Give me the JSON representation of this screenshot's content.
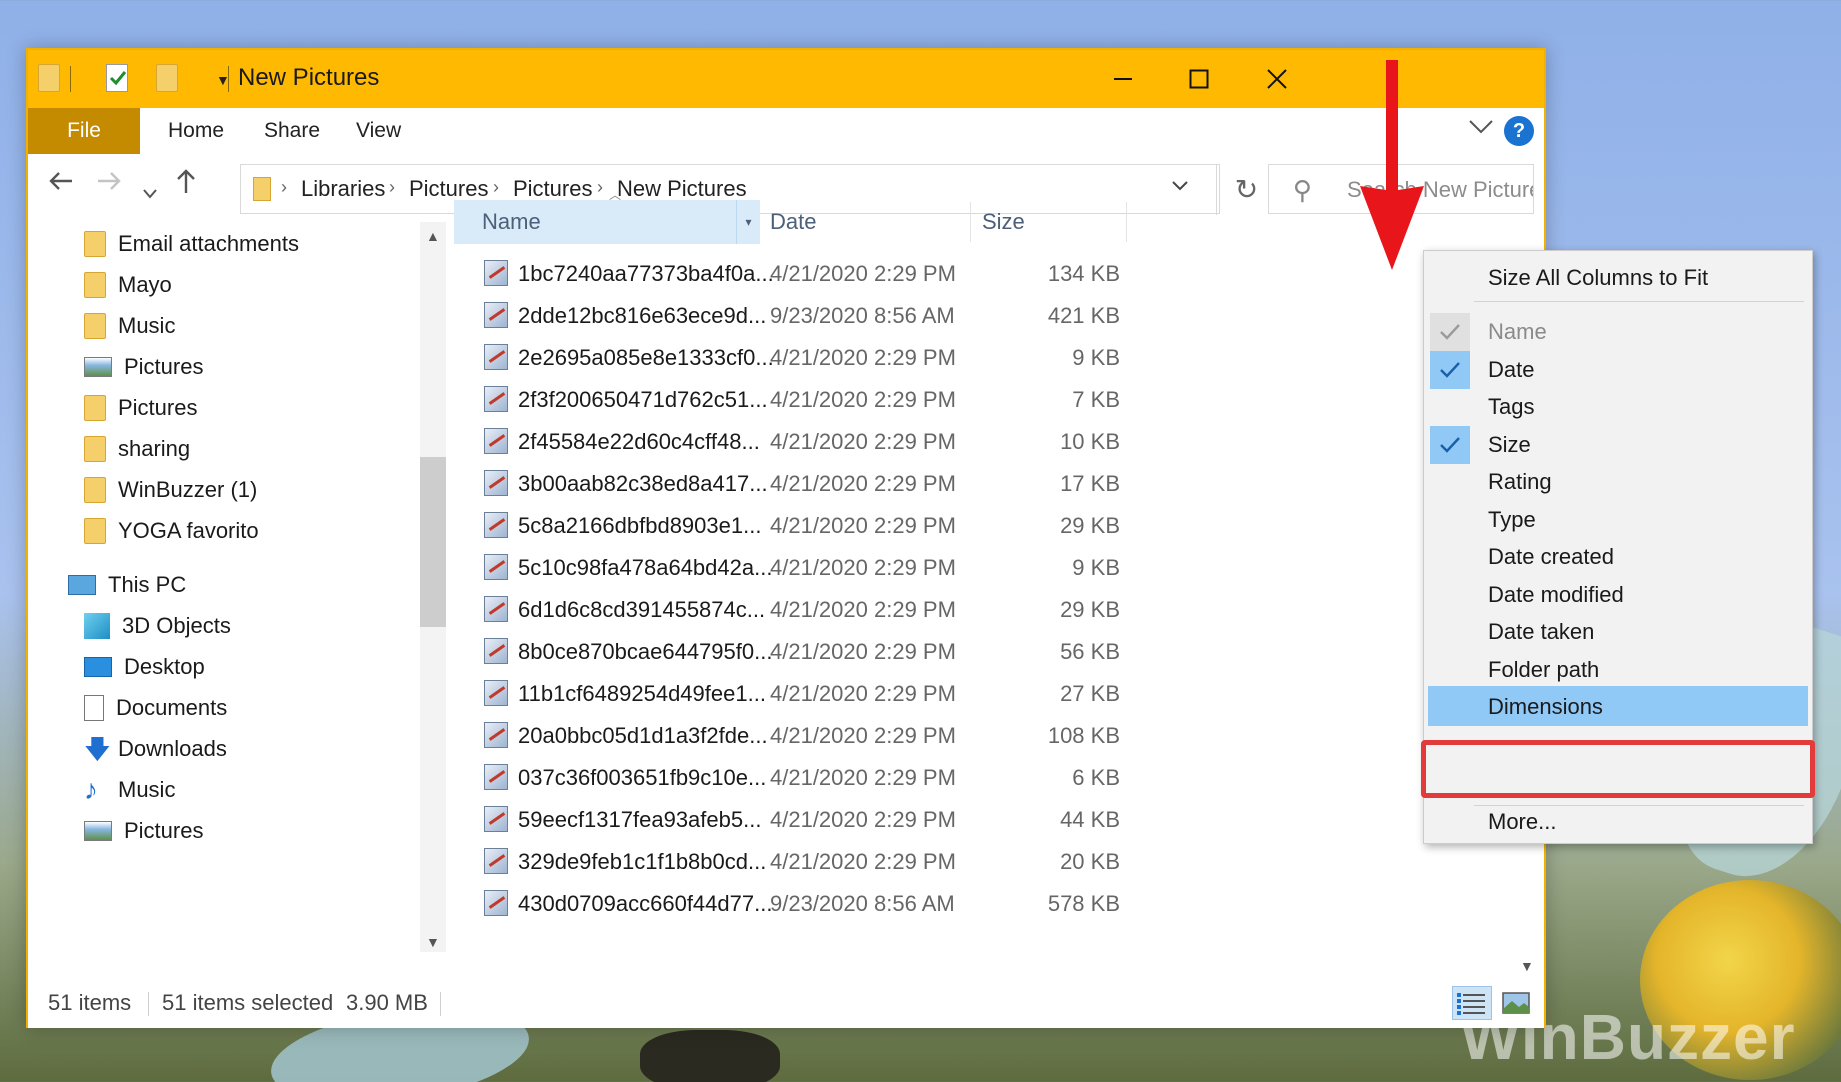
{
  "window": {
    "title": "New Pictures"
  },
  "ribbon": {
    "tabs": [
      "File",
      "Home",
      "Share",
      "View"
    ]
  },
  "address": {
    "crumbs": [
      "Libraries",
      "Pictures",
      "Pictures",
      "New Pictures"
    ]
  },
  "search": {
    "placeholder": "Search New Pictures"
  },
  "nav_pane": {
    "items": [
      {
        "label": "Email attachments",
        "icon": "folder-icon"
      },
      {
        "label": "Mayo",
        "icon": "folder-icon"
      },
      {
        "label": "Music",
        "icon": "folder-icon"
      },
      {
        "label": "Pictures",
        "icon": "pictures-icon"
      },
      {
        "label": "Pictures",
        "icon": "folder-icon"
      },
      {
        "label": "sharing",
        "icon": "folder-icon"
      },
      {
        "label": "WinBuzzer (1)",
        "icon": "folder-icon"
      },
      {
        "label": "YOGA favorito",
        "icon": "folder-icon"
      },
      {
        "label": "This PC",
        "icon": "computer-icon"
      },
      {
        "label": "3D Objects",
        "icon": "cube-icon"
      },
      {
        "label": "Desktop",
        "icon": "desktop-icon"
      },
      {
        "label": "Documents",
        "icon": "document-icon"
      },
      {
        "label": "Downloads",
        "icon": "download-arrow-icon"
      },
      {
        "label": "Music",
        "icon": "music-note-icon"
      },
      {
        "label": "Pictures",
        "icon": "pictures-icon"
      }
    ]
  },
  "columns": {
    "name": "Name",
    "date": "Date",
    "size": "Size"
  },
  "files": [
    {
      "name": "1bc7240aa77373ba4f0a...",
      "date": "4/21/2020 2:29 PM",
      "size": "134 KB"
    },
    {
      "name": "2dde12bc816e63ece9d...",
      "date": "9/23/2020 8:56 AM",
      "size": "421 KB"
    },
    {
      "name": "2e2695a085e8e1333cf0...",
      "date": "4/21/2020 2:29 PM",
      "size": "9 KB"
    },
    {
      "name": "2f3f200650471d762c51...",
      "date": "4/21/2020 2:29 PM",
      "size": "7 KB"
    },
    {
      "name": "2f45584e22d60c4cff48...",
      "date": "4/21/2020 2:29 PM",
      "size": "10 KB"
    },
    {
      "name": "3b00aab82c38ed8a417...",
      "date": "4/21/2020 2:29 PM",
      "size": "17 KB"
    },
    {
      "name": "5c8a2166dbfbd8903e1...",
      "date": "4/21/2020 2:29 PM",
      "size": "29 KB"
    },
    {
      "name": "5c10c98fa478a64bd42a...",
      "date": "4/21/2020 2:29 PM",
      "size": "9 KB"
    },
    {
      "name": "6d1d6c8cd391455874c...",
      "date": "4/21/2020 2:29 PM",
      "size": "29 KB"
    },
    {
      "name": "8b0ce870bcae644795f0...",
      "date": "4/21/2020 2:29 PM",
      "size": "56 KB"
    },
    {
      "name": "11b1cf6489254d49fee1...",
      "date": "4/21/2020 2:29 PM",
      "size": "27 KB"
    },
    {
      "name": "20a0bbc05d1d1a3f2fde...",
      "date": "4/21/2020 2:29 PM",
      "size": "108 KB"
    },
    {
      "name": "037c36f003651fb9c10e...",
      "date": "4/21/2020 2:29 PM",
      "size": "6 KB"
    },
    {
      "name": "59eecf1317fea93afeb5...",
      "date": "4/21/2020 2:29 PM",
      "size": "44 KB"
    },
    {
      "name": "329de9feb1c1f1b8b0cd...",
      "date": "4/21/2020 2:29 PM",
      "size": "20 KB"
    },
    {
      "name": "430d0709acc660f44d77...",
      "date": "9/23/2020 8:56 AM",
      "size": "578 KB"
    }
  ],
  "context_menu": {
    "top_item": "Size All Columns to Fit",
    "items": [
      {
        "label": "Name",
        "checked": true,
        "disabled": true
      },
      {
        "label": "Date",
        "checked": true,
        "disabled": false
      },
      {
        "label": "Tags",
        "checked": false,
        "disabled": false
      },
      {
        "label": "Size",
        "checked": true,
        "disabled": false
      },
      {
        "label": "Rating",
        "checked": false,
        "disabled": false
      },
      {
        "label": "Type",
        "checked": false,
        "disabled": false
      },
      {
        "label": "Date created",
        "checked": false,
        "disabled": false
      },
      {
        "label": "Date modified",
        "checked": false,
        "disabled": false
      },
      {
        "label": "Date taken",
        "checked": false,
        "disabled": false
      },
      {
        "label": "Folder path",
        "checked": false,
        "disabled": false
      },
      {
        "label": "Dimensions",
        "checked": false,
        "disabled": false,
        "highlighted": true
      }
    ],
    "more": "More..."
  },
  "status": {
    "items": "51 items",
    "selected": "51 items selected",
    "size": "3.90 MB"
  },
  "watermark": "WinBuzzer",
  "colors": {
    "titlebar": "#ffb900",
    "file_tab": "#c48a00",
    "selection": "#90c8f6",
    "highlight_border": "#e23b3b"
  }
}
